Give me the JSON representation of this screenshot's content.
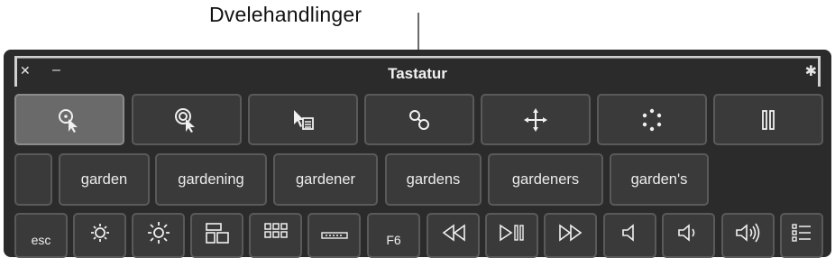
{
  "callout": {
    "label": "Dvelehandlinger"
  },
  "window": {
    "title": "Tastatur"
  },
  "dwell_row": {
    "icons": [
      "left-click-icon",
      "double-click-icon",
      "context-menu-icon",
      "drag-drop-icon",
      "scroll-menu-icon",
      "position-icon",
      "pause-icon"
    ]
  },
  "suggestions": {
    "items": [
      "garden",
      "gardening",
      "gardener",
      "gardens",
      "gardeners",
      "garden's"
    ]
  },
  "function_row": {
    "esc_label": "esc",
    "f6_label": "F6",
    "icons": [
      "brightness-down-icon",
      "brightness-up-icon",
      "mission-control-icon",
      "launchpad-icon",
      "keyboard-illumination-icon",
      "rewind-icon",
      "play-pause-icon",
      "fast-forward-icon",
      "mute-icon",
      "volume-down-icon",
      "volume-up-icon",
      "menu-list-icon"
    ]
  },
  "colors": {
    "panel": "#2b2b2b",
    "key": "#3a3a3a",
    "key_active": "#6a6a6a",
    "text": "#efefef"
  }
}
